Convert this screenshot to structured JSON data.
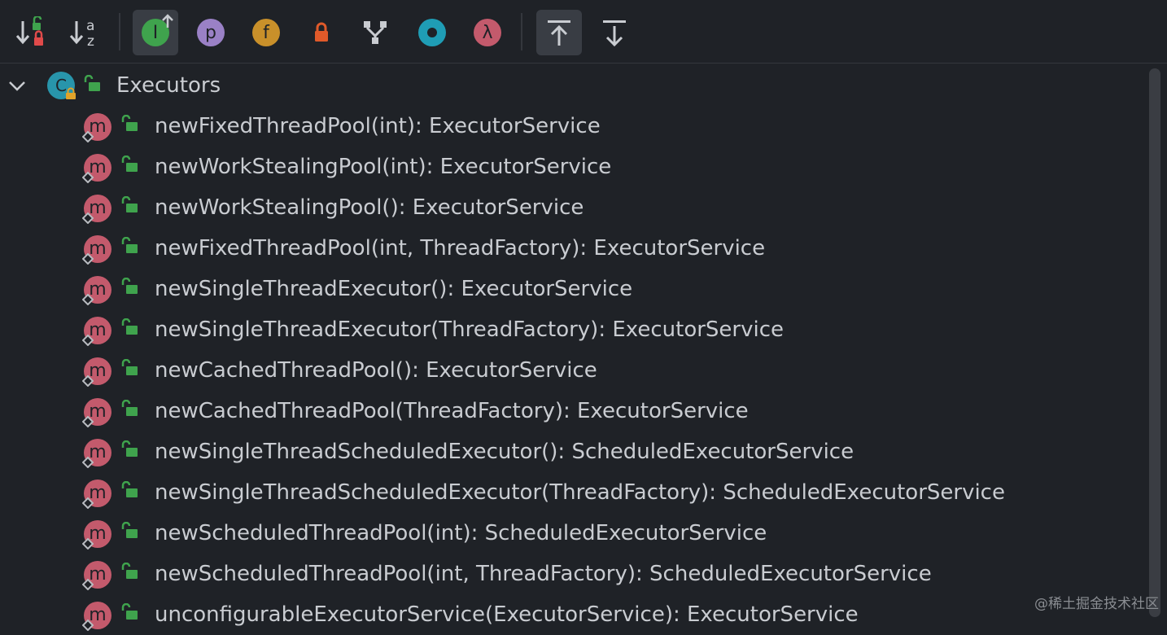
{
  "toolbar": {
    "sort_visibility_icon": "sort-by-visibility-icon",
    "sort_alpha_a": "a",
    "sort_alpha_z": "z",
    "show_inherited_letter": "I",
    "show_properties_letter": "p",
    "show_fields_letter": "f",
    "show_lambdas_letter": "λ"
  },
  "tree": {
    "root_label": "Executors",
    "root_icon_letter": "C",
    "method_icon_letter": "m",
    "methods": [
      "newFixedThreadPool(int): ExecutorService",
      "newWorkStealingPool(int): ExecutorService",
      "newWorkStealingPool(): ExecutorService",
      "newFixedThreadPool(int, ThreadFactory): ExecutorService",
      "newSingleThreadExecutor(): ExecutorService",
      "newSingleThreadExecutor(ThreadFactory): ExecutorService",
      "newCachedThreadPool(): ExecutorService",
      "newCachedThreadPool(ThreadFactory): ExecutorService",
      "newSingleThreadScheduledExecutor(): ScheduledExecutorService",
      "newSingleThreadScheduledExecutor(ThreadFactory): ScheduledExecutorService",
      "newScheduledThreadPool(int): ScheduledExecutorService",
      "newScheduledThreadPool(int, ThreadFactory): ScheduledExecutorService",
      "unconfigurableExecutorService(ExecutorService): ExecutorService"
    ]
  },
  "watermark": "@稀土掘金技术社区",
  "colors": {
    "background": "#1f2227",
    "method_icon": "#c35a6c",
    "class_icon": "#2895ab",
    "lock_green": "#3fa34d",
    "text": "#c9ccd1"
  }
}
